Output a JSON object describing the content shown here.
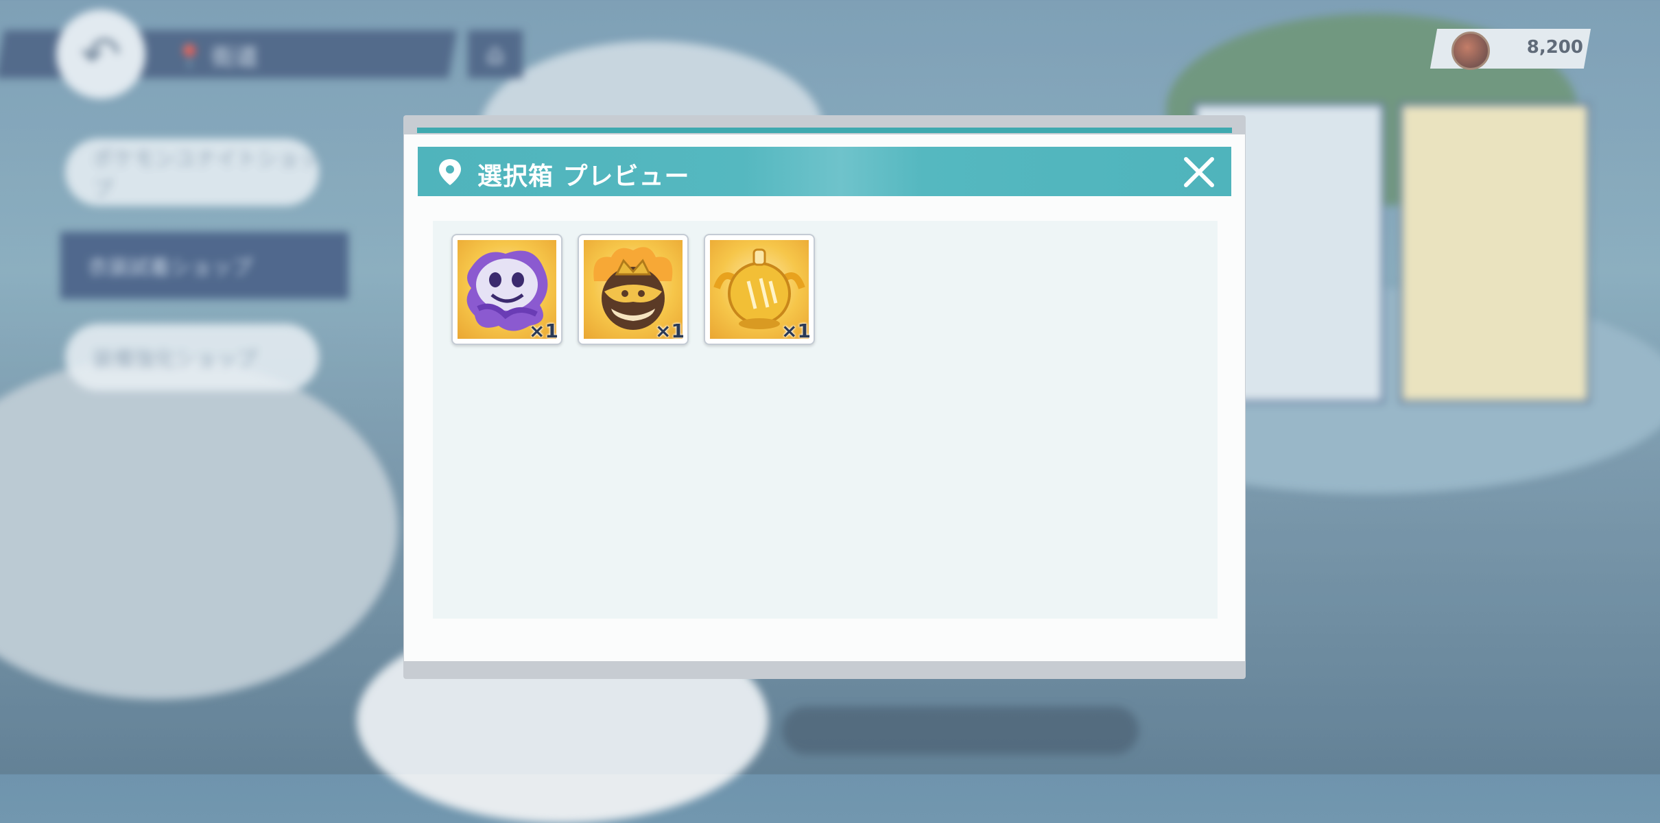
{
  "background": {
    "location_label": "街道",
    "menu_items": [
      "ポケモンユナイトショップ",
      "衣装試着ショップ",
      "装備強化ショップ"
    ],
    "currency": {
      "icon": "aeos-coin-icon",
      "value": "8,200"
    }
  },
  "modal": {
    "title": "選択箱 プレビュー",
    "title_icon": "map-pin-icon",
    "close_icon": "close-icon",
    "items": [
      {
        "icon": "purple-ghost-emblem-icon",
        "quantity": "×1"
      },
      {
        "icon": "golden-crown-pot-emblem-icon",
        "quantity": "×1"
      },
      {
        "icon": "golden-bell-emblem-icon",
        "quantity": "×1"
      }
    ]
  },
  "colors": {
    "header_teal": "#4fb4bc",
    "panel_bg": "#eef5f6",
    "item_gold": "#f6c64a",
    "background_navy": "#3a5378"
  }
}
